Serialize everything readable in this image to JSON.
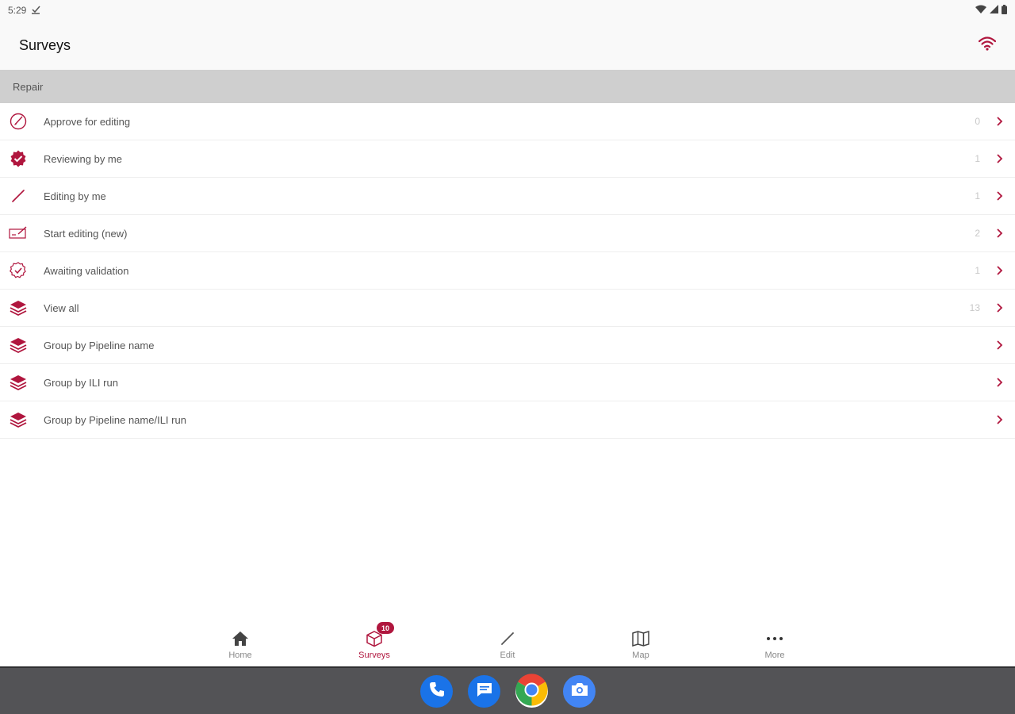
{
  "status_bar": {
    "time": "5:29"
  },
  "app_bar": {
    "title": "Surveys"
  },
  "section": {
    "label": "Repair"
  },
  "list": [
    {
      "label": "Approve for editing",
      "count": "0",
      "icon": "approve-edit-icon"
    },
    {
      "label": "Reviewing by me",
      "count": "1",
      "icon": "verified-badge-icon"
    },
    {
      "label": "Editing by me",
      "count": "1",
      "icon": "pencil-icon"
    },
    {
      "label": "Start editing (new)",
      "count": "2",
      "icon": "signature-icon"
    },
    {
      "label": "Awaiting validation",
      "count": "1",
      "icon": "check-circle-icon"
    },
    {
      "label": "View all",
      "count": "13",
      "icon": "layers-icon"
    },
    {
      "label": "Group by Pipeline name",
      "count": "",
      "icon": "layers-icon"
    },
    {
      "label": "Group by ILI run",
      "count": "",
      "icon": "layers-icon"
    },
    {
      "label": "Group by Pipeline name/ILI run",
      "count": "",
      "icon": "layers-icon"
    }
  ],
  "bottom_nav": {
    "home": "Home",
    "surveys": "Surveys",
    "surveys_badge": "10",
    "edit": "Edit",
    "map": "Map",
    "more": "More"
  },
  "colors": {
    "accent": "#b0163e",
    "section_bg": "#cfcfcf",
    "dock_bg": "#535356"
  }
}
